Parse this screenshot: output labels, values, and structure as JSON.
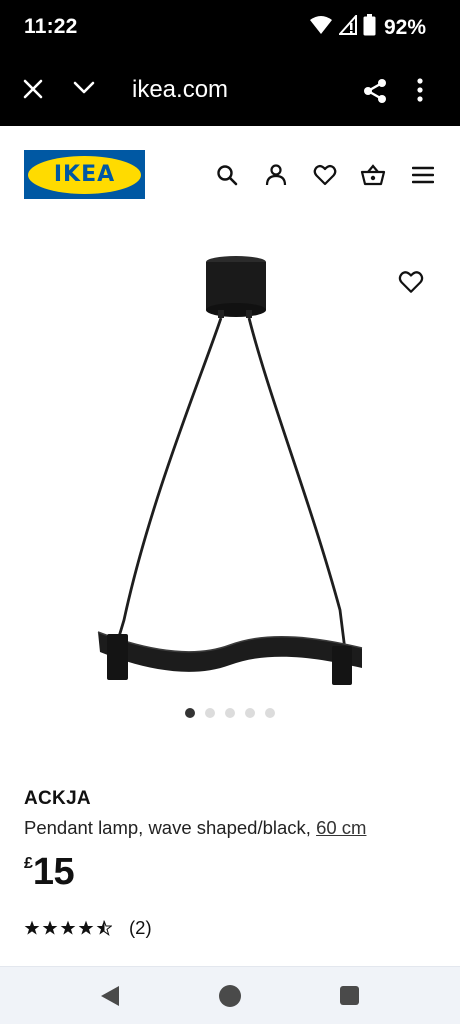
{
  "status_bar": {
    "time": "11:22",
    "battery": "92%",
    "icons": [
      "wifi-icon",
      "signal-icon",
      "battery-icon"
    ]
  },
  "browser": {
    "url": "ikea.com",
    "icons": [
      "close-icon",
      "chevron-down-icon",
      "share-icon",
      "more-vert-icon"
    ]
  },
  "header": {
    "logo_text": "IKEA",
    "icons": [
      "search-icon",
      "account-icon",
      "heart-icon",
      "basket-icon",
      "menu-icon"
    ],
    "colors": {
      "logo_blue": "#0058a3",
      "logo_yellow": "#ffdb00"
    }
  },
  "product": {
    "image_icon": "pendant-lamp-image",
    "carousel": {
      "total": 5,
      "active": 1
    },
    "name": "ACKJA",
    "description": "Pendant lamp, wave shaped/black,",
    "size": "60 cm",
    "currency": "£",
    "price": "15",
    "rating": {
      "stars": 4.5,
      "count": "(2)"
    }
  },
  "nav": {
    "icons": [
      "back-icon",
      "home-icon",
      "recents-icon"
    ]
  }
}
